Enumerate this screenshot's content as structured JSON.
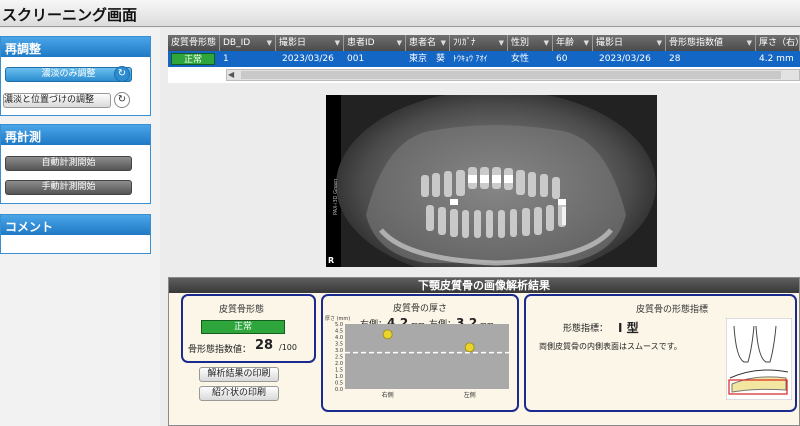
{
  "window": {
    "title": "スクリーニング画面"
  },
  "sidebar": {
    "readjust": {
      "header": "再調整",
      "density_only": "濃淡のみ調整",
      "density_position": "濃淡と位置づけの調整"
    },
    "remeasure": {
      "header": "再計測",
      "auto": "自動計測開始",
      "manual": "手動計測開始"
    },
    "comment": {
      "header": "コメント"
    }
  },
  "table": {
    "headers": [
      "皮質骨形態",
      "DB_ID",
      "撮影日",
      "患者ID",
      "患者名",
      "ﾌﾘｶﾞﾅ",
      "性別",
      "年齢",
      "撮影日",
      "骨形態指数値",
      "厚さ（右）"
    ],
    "row": {
      "status": "正常",
      "db_id": "1",
      "date": "2023/03/26",
      "patient_id": "001",
      "name": "東京　葵",
      "kana": "ﾄｳｷｮｳ ｱｵｲ",
      "sex": "女性",
      "age": "60",
      "date2": "2023/03/26",
      "index": "28",
      "thickness": "4.2 mm"
    }
  },
  "xray": {
    "side_text": "PAX-i3D Green",
    "corner_label": "R"
  },
  "results": {
    "header": "下顎皮質骨の画像解析結果",
    "morphology": {
      "title": "皮質骨形態",
      "status": "正常",
      "index_label": "骨形態指数値：",
      "index_value": "28",
      "index_max": "/100",
      "print_analysis": "解析結果の印刷",
      "print_referral": "紹介状の印刷"
    },
    "thickness": {
      "title": "皮質骨の厚さ",
      "right_label": "右側：",
      "right_value": "4.2",
      "left_label": "左側：",
      "left_value": "3.2",
      "unit": "mm",
      "y_axis_label": "厚さ (mm)",
      "x_labels": [
        "右側",
        "左側"
      ]
    },
    "shape": {
      "title": "皮質骨の形態指標",
      "index_label": "形態指標：",
      "index_value": "I 型",
      "description": "両側皮質骨の内側表面はスムースです。"
    }
  },
  "colors": {
    "accent": "#1466c4",
    "ok_green": "#2ea63c",
    "box_border": "#1b2a8e",
    "marker": "#e8d42a"
  },
  "chart_data": {
    "type": "scatter",
    "categories": [
      "右側",
      "左側"
    ],
    "values": [
      4.2,
      3.2
    ],
    "ylim": [
      0,
      5.0
    ],
    "yticks": [
      0.0,
      0.5,
      1.0,
      1.5,
      2.0,
      2.5,
      3.0,
      3.5,
      4.0,
      4.5,
      5.0
    ],
    "threshold": 2.8,
    "ylabel": "厚さ (mm)",
    "grid": false
  }
}
